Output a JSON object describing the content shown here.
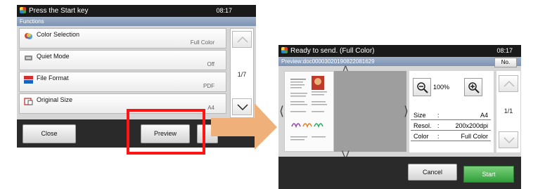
{
  "screen1": {
    "title": "Press the Start key",
    "time": "08:17",
    "subtitle": "Functions",
    "items": [
      {
        "label": "Color Selection",
        "value": "Full Color"
      },
      {
        "label": "Quiet Mode",
        "value": "Off"
      },
      {
        "label": "File Format",
        "value": "PDF"
      },
      {
        "label": "Original Size",
        "value": "A4"
      }
    ],
    "page_indicator": "1/7",
    "close_label": "Close",
    "preview_label": "Preview"
  },
  "screen2": {
    "title": "Ready to send. (Full Color)",
    "time": "08:17",
    "subtitle": "Preview:doc00003020190822081629",
    "no_label": "No.",
    "zoom": "100%",
    "size_label": "Size",
    "size_value": "A4",
    "resol_label": "Resol.",
    "resol_value": "200x200dpi",
    "color_label": "Color",
    "color_value": "Full Color",
    "page_indicator": "1/1",
    "cancel_label": "Cancel",
    "start_label": "Start"
  },
  "colors": {
    "highlight": "#ff1414",
    "arrow": "#f0b07a",
    "start": "#2f9f3a"
  }
}
